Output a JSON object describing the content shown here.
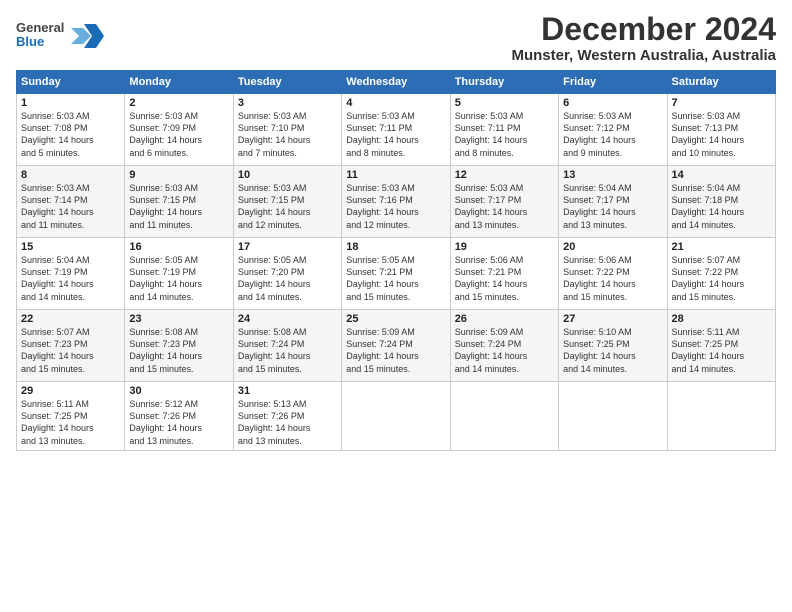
{
  "logo": {
    "line1": "General",
    "line2": "Blue"
  },
  "title": "December 2024",
  "subtitle": "Munster, Western Australia, Australia",
  "days_of_week": [
    "Sunday",
    "Monday",
    "Tuesday",
    "Wednesday",
    "Thursday",
    "Friday",
    "Saturday"
  ],
  "weeks": [
    [
      {
        "day": "1",
        "text": "Sunrise: 5:03 AM\nSunset: 7:08 PM\nDaylight: 14 hours\nand 5 minutes."
      },
      {
        "day": "2",
        "text": "Sunrise: 5:03 AM\nSunset: 7:09 PM\nDaylight: 14 hours\nand 6 minutes."
      },
      {
        "day": "3",
        "text": "Sunrise: 5:03 AM\nSunset: 7:10 PM\nDaylight: 14 hours\nand 7 minutes."
      },
      {
        "day": "4",
        "text": "Sunrise: 5:03 AM\nSunset: 7:11 PM\nDaylight: 14 hours\nand 8 minutes."
      },
      {
        "day": "5",
        "text": "Sunrise: 5:03 AM\nSunset: 7:11 PM\nDaylight: 14 hours\nand 8 minutes."
      },
      {
        "day": "6",
        "text": "Sunrise: 5:03 AM\nSunset: 7:12 PM\nDaylight: 14 hours\nand 9 minutes."
      },
      {
        "day": "7",
        "text": "Sunrise: 5:03 AM\nSunset: 7:13 PM\nDaylight: 14 hours\nand 10 minutes."
      }
    ],
    [
      {
        "day": "8",
        "text": "Sunrise: 5:03 AM\nSunset: 7:14 PM\nDaylight: 14 hours\nand 11 minutes."
      },
      {
        "day": "9",
        "text": "Sunrise: 5:03 AM\nSunset: 7:15 PM\nDaylight: 14 hours\nand 11 minutes."
      },
      {
        "day": "10",
        "text": "Sunrise: 5:03 AM\nSunset: 7:15 PM\nDaylight: 14 hours\nand 12 minutes."
      },
      {
        "day": "11",
        "text": "Sunrise: 5:03 AM\nSunset: 7:16 PM\nDaylight: 14 hours\nand 12 minutes."
      },
      {
        "day": "12",
        "text": "Sunrise: 5:03 AM\nSunset: 7:17 PM\nDaylight: 14 hours\nand 13 minutes."
      },
      {
        "day": "13",
        "text": "Sunrise: 5:04 AM\nSunset: 7:17 PM\nDaylight: 14 hours\nand 13 minutes."
      },
      {
        "day": "14",
        "text": "Sunrise: 5:04 AM\nSunset: 7:18 PM\nDaylight: 14 hours\nand 14 minutes."
      }
    ],
    [
      {
        "day": "15",
        "text": "Sunrise: 5:04 AM\nSunset: 7:19 PM\nDaylight: 14 hours\nand 14 minutes."
      },
      {
        "day": "16",
        "text": "Sunrise: 5:05 AM\nSunset: 7:19 PM\nDaylight: 14 hours\nand 14 minutes."
      },
      {
        "day": "17",
        "text": "Sunrise: 5:05 AM\nSunset: 7:20 PM\nDaylight: 14 hours\nand 14 minutes."
      },
      {
        "day": "18",
        "text": "Sunrise: 5:05 AM\nSunset: 7:21 PM\nDaylight: 14 hours\nand 15 minutes."
      },
      {
        "day": "19",
        "text": "Sunrise: 5:06 AM\nSunset: 7:21 PM\nDaylight: 14 hours\nand 15 minutes."
      },
      {
        "day": "20",
        "text": "Sunrise: 5:06 AM\nSunset: 7:22 PM\nDaylight: 14 hours\nand 15 minutes."
      },
      {
        "day": "21",
        "text": "Sunrise: 5:07 AM\nSunset: 7:22 PM\nDaylight: 14 hours\nand 15 minutes."
      }
    ],
    [
      {
        "day": "22",
        "text": "Sunrise: 5:07 AM\nSunset: 7:23 PM\nDaylight: 14 hours\nand 15 minutes."
      },
      {
        "day": "23",
        "text": "Sunrise: 5:08 AM\nSunset: 7:23 PM\nDaylight: 14 hours\nand 15 minutes."
      },
      {
        "day": "24",
        "text": "Sunrise: 5:08 AM\nSunset: 7:24 PM\nDaylight: 14 hours\nand 15 minutes."
      },
      {
        "day": "25",
        "text": "Sunrise: 5:09 AM\nSunset: 7:24 PM\nDaylight: 14 hours\nand 15 minutes."
      },
      {
        "day": "26",
        "text": "Sunrise: 5:09 AM\nSunset: 7:24 PM\nDaylight: 14 hours\nand 14 minutes."
      },
      {
        "day": "27",
        "text": "Sunrise: 5:10 AM\nSunset: 7:25 PM\nDaylight: 14 hours\nand 14 minutes."
      },
      {
        "day": "28",
        "text": "Sunrise: 5:11 AM\nSunset: 7:25 PM\nDaylight: 14 hours\nand 14 minutes."
      }
    ],
    [
      {
        "day": "29",
        "text": "Sunrise: 5:11 AM\nSunset: 7:25 PM\nDaylight: 14 hours\nand 13 minutes."
      },
      {
        "day": "30",
        "text": "Sunrise: 5:12 AM\nSunset: 7:26 PM\nDaylight: 14 hours\nand 13 minutes."
      },
      {
        "day": "31",
        "text": "Sunrise: 5:13 AM\nSunset: 7:26 PM\nDaylight: 14 hours\nand 13 minutes."
      },
      {
        "day": "",
        "text": ""
      },
      {
        "day": "",
        "text": ""
      },
      {
        "day": "",
        "text": ""
      },
      {
        "day": "",
        "text": ""
      }
    ]
  ]
}
